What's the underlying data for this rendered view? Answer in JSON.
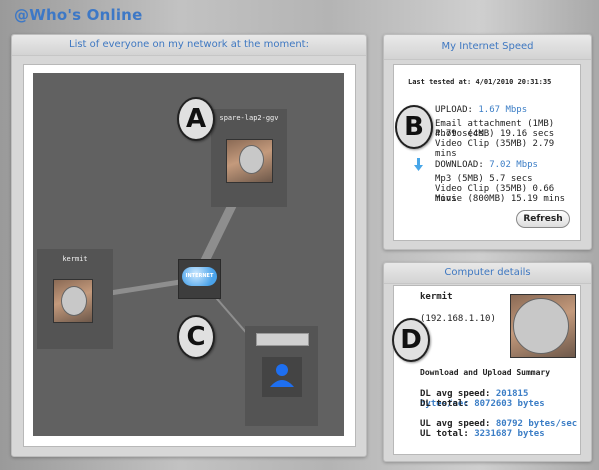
{
  "app": {
    "title": "@Who's Online"
  },
  "network": {
    "header": "List of everyone on my network at the moment:",
    "nodes": [
      {
        "name": "spare-lap2-ggv"
      },
      {
        "name": "kermit"
      },
      {
        "name": ""
      }
    ],
    "hub": {
      "label": "INTERNET"
    },
    "callouts": [
      "A",
      "B",
      "C",
      "D"
    ]
  },
  "speed": {
    "header": "My Internet Speed",
    "last_tested_label": "Last tested at:",
    "last_tested": "4/01/2010 20:31:35",
    "upload": {
      "label": "UPLOAD:",
      "value": "1.67 Mbps",
      "items": [
        {
          "label": "Email attachment (1MB)",
          "value": "4.79 secs"
        },
        {
          "label": "Photo (4MB)",
          "value": "19.16 secs"
        },
        {
          "label": "Video Clip (35MB)",
          "value": "2.79 mins"
        }
      ]
    },
    "download": {
      "label": "DOWNLOAD:",
      "value": "7.02 Mbps",
      "items": [
        {
          "label": "Mp3 (5MB)",
          "value": "5.7 secs"
        },
        {
          "label": "Video Clip (35MB)",
          "value": "0.66 mins"
        },
        {
          "label": "Movie (800MB)",
          "value": "15.19 mins"
        }
      ]
    },
    "refresh_label": "Refresh"
  },
  "computer": {
    "header": "Computer details",
    "name": "kermit",
    "ip": "(192.168.1.10)",
    "summary_title": "Download and Upload Summary",
    "dl_avg_label": "DL avg speed:",
    "dl_avg": "201815 bytes/sec",
    "dl_total_label": "DL total:",
    "dl_total": "8072603 bytes",
    "ul_avg_label": "UL avg speed:",
    "ul_avg": "80792 bytes/sec",
    "ul_total_label": "UL total:",
    "ul_total": "3231687 bytes"
  }
}
